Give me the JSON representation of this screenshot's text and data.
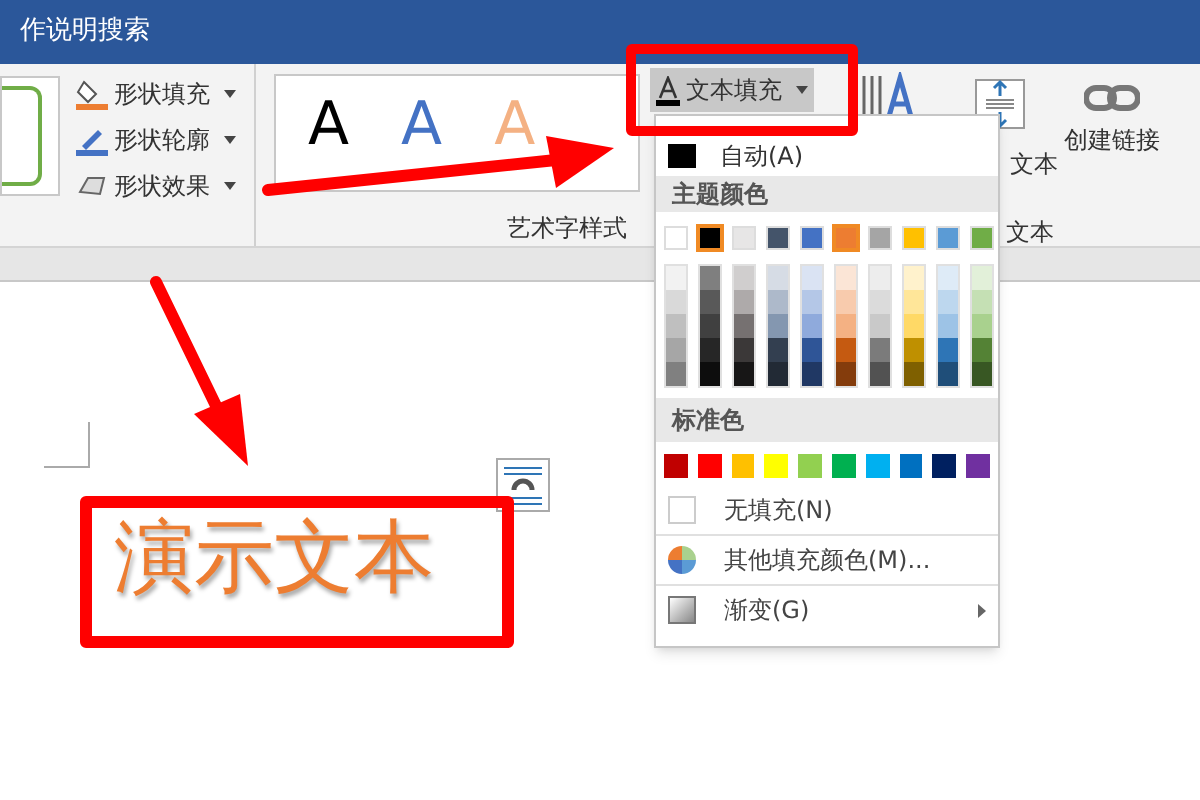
{
  "title_bar": {
    "search": "作说明搜索"
  },
  "ribbon": {
    "shape_commands": [
      {
        "label": "形状填充",
        "kind": "fill"
      },
      {
        "label": "形状轮廓",
        "kind": "outline"
      },
      {
        "label": "形状效果",
        "kind": "effects"
      }
    ],
    "wordart_group": {
      "samples": [
        {
          "glyph": "A",
          "color": "#000000"
        },
        {
          "glyph": "A",
          "color": "#4472c4"
        },
        {
          "glyph": "A",
          "color": "#f4b183"
        }
      ],
      "label": "艺术字样式"
    },
    "text_fill_button": {
      "label": "文本填充",
      "expanded": true
    },
    "text_group": {
      "align_text": "文本",
      "create_link": "创建链接",
      "label": "文本"
    }
  },
  "fill_menu": {
    "automatic": "自动(A)",
    "theme_header": "主题颜色",
    "theme_colors": [
      {
        "color": "#ffffff",
        "highlighted": false,
        "shades": [
          {
            "color": "#f2f2f2"
          },
          {
            "color": "#d9d9d9"
          },
          {
            "color": "#bfbfbf"
          },
          {
            "color": "#a6a6a6"
          },
          {
            "color": "#808080"
          }
        ]
      },
      {
        "color": "#000000",
        "highlighted": true,
        "shades": [
          {
            "color": "#7f7f7f"
          },
          {
            "color": "#595959"
          },
          {
            "color": "#404040"
          },
          {
            "color": "#262626"
          },
          {
            "color": "#0d0d0d"
          }
        ]
      },
      {
        "color": "#e7e6e6",
        "highlighted": false,
        "shades": [
          {
            "color": "#d0cece"
          },
          {
            "color": "#aeaaaa"
          },
          {
            "color": "#767171"
          },
          {
            "color": "#3b3838"
          },
          {
            "color": "#171616"
          }
        ]
      },
      {
        "color": "#44546a",
        "highlighted": false,
        "shades": [
          {
            "color": "#d6dce5"
          },
          {
            "color": "#adb9ca"
          },
          {
            "color": "#8497b0"
          },
          {
            "color": "#333f50"
          },
          {
            "color": "#222a35"
          }
        ]
      },
      {
        "color": "#4472c4",
        "highlighted": false,
        "shades": [
          {
            "color": "#dae3f3"
          },
          {
            "color": "#b4c7e7"
          },
          {
            "color": "#8faadc"
          },
          {
            "color": "#2f5597"
          },
          {
            "color": "#203864"
          }
        ]
      },
      {
        "color": "#ed7d31",
        "highlighted": true,
        "shades": [
          {
            "color": "#fbe5d6"
          },
          {
            "color": "#f8cbad"
          },
          {
            "color": "#f4b183"
          },
          {
            "color": "#c55a11"
          },
          {
            "color": "#843c0c"
          }
        ]
      },
      {
        "color": "#a5a5a5",
        "highlighted": false,
        "shades": [
          {
            "color": "#ededed"
          },
          {
            "color": "#dbdbdb"
          },
          {
            "color": "#c9c9c9"
          },
          {
            "color": "#7b7b7b"
          },
          {
            "color": "#525252"
          }
        ]
      },
      {
        "color": "#ffc000",
        "highlighted": false,
        "shades": [
          {
            "color": "#fff2cc"
          },
          {
            "color": "#ffe699"
          },
          {
            "color": "#ffd966"
          },
          {
            "color": "#bf9000"
          },
          {
            "color": "#7f6000"
          }
        ]
      },
      {
        "color": "#5b9bd5",
        "highlighted": false,
        "shades": [
          {
            "color": "#deebf7"
          },
          {
            "color": "#bdd7ee"
          },
          {
            "color": "#9dc3e6"
          },
          {
            "color": "#2e75b6"
          },
          {
            "color": "#1f4e79"
          }
        ]
      },
      {
        "color": "#70ad47",
        "highlighted": false,
        "shades": [
          {
            "color": "#e2f0d9"
          },
          {
            "color": "#c5e0b4"
          },
          {
            "color": "#a9d18e"
          },
          {
            "color": "#548235"
          },
          {
            "color": "#385723"
          }
        ]
      }
    ],
    "standard_header": "标准色",
    "standard_colors": [
      {
        "color": "#c00000"
      },
      {
        "color": "#ff0000"
      },
      {
        "color": "#ffc000"
      },
      {
        "color": "#ffff00"
      },
      {
        "color": "#92d050"
      },
      {
        "color": "#00b050"
      },
      {
        "color": "#00b0f0"
      },
      {
        "color": "#0070c0"
      },
      {
        "color": "#002060"
      },
      {
        "color": "#7030a0"
      }
    ],
    "items": [
      {
        "label": "无填充(N)",
        "kind": "none"
      },
      {
        "label": "其他填充颜色(M)...",
        "kind": "more"
      },
      {
        "label": "渐变(G)",
        "kind": "gradient"
      }
    ]
  },
  "document": {
    "text_box": "演示文本"
  }
}
